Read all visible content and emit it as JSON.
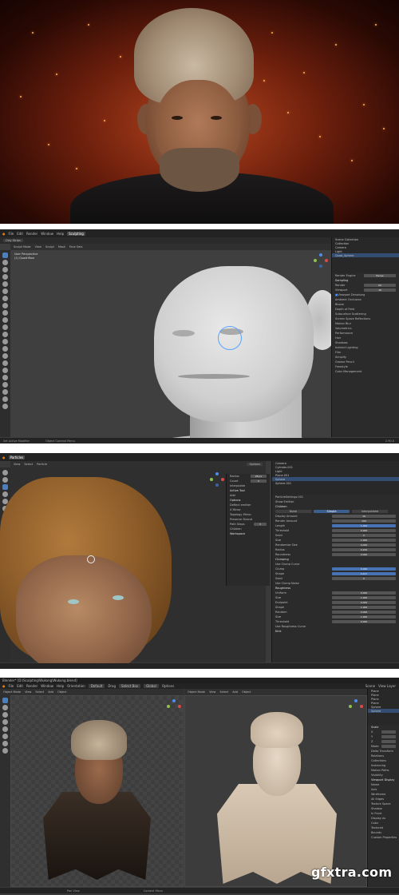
{
  "panel2": {
    "menu": [
      "File",
      "Edit",
      "Render",
      "Window",
      "Help"
    ],
    "workspace_tab": "Sculpting",
    "brush_name": "Clay Strips",
    "mode": "Sculpt Mode",
    "viewport_title": "User Perspective",
    "viewport_subtitle": "(1) Quadriflow",
    "header_menus": [
      "Sculpt Mode",
      "View",
      "Sculpt",
      "Mask",
      "Face Sets"
    ],
    "outliner_title": "Scene Collection",
    "outliner_items": [
      "Collection",
      "Camera",
      "Light",
      "Quad_Sphere"
    ],
    "props": {
      "render_engine_label": "Render Engine",
      "render_engine": "Eevee",
      "sampling": "Sampling",
      "render_label": "Render",
      "render_value": "64",
      "viewport_label": "Viewport",
      "viewport_value": "16",
      "viewport_denoising": "Viewport Denoising",
      "sections": [
        "Ambient Occlusion",
        "Bloom",
        "Depth of Field",
        "Subsurface Scattering",
        "Screen Space Reflections",
        "Motion Blur",
        "Volumetrics",
        "Performance",
        "Hair",
        "Shadows",
        "Indirect Lighting",
        "Film",
        "Simplify",
        "Grease Pencil",
        "Freestyle",
        "Color Management"
      ]
    },
    "status_left": "Set Active Modifier",
    "status_mid": "Object Context Menu",
    "version": "2.90.0"
  },
  "panel3": {
    "top_tab": "Particles",
    "header_menus": [
      "View",
      "Select",
      "Particle"
    ],
    "options_label": "Options",
    "tool_settings": {
      "radius_label": "Radius",
      "radius_value": "28 px",
      "count_label": "Count",
      "count_value": "2",
      "interpolate": "Interpolate",
      "active_tool": "Active Tool",
      "add": "Add",
      "options": "Options",
      "deflect": "Deflect emitter",
      "x_mirror": "X Mirror",
      "topology_mirror": "Topology Mirror",
      "preserve_strand": "Preserve Strand",
      "path_steps": "Path Steps",
      "path_value": "3",
      "children": "Children",
      "workspace": "Workspace"
    },
    "outliner_items": [
      "Camera",
      "Cylinder.001",
      "Light",
      "Plane.001",
      "Sphere",
      "Sphere.001"
    ],
    "particle_settings": "ParticleSettings.001",
    "props": {
      "show_emitter": "Show Emitter",
      "children": "Children",
      "tabs": [
        "None",
        "Simple",
        "Interpolated"
      ],
      "rows": [
        [
          "Display Amount",
          "10"
        ],
        [
          "Render Amount",
          "100"
        ],
        [
          "Length",
          "1.000"
        ],
        [
          "Threshold",
          "0.000"
        ],
        [
          "Seed",
          "0"
        ],
        [
          "Size",
          "1.000"
        ],
        [
          "Randomize Size",
          "0.000"
        ],
        [
          "Radius",
          "0.200"
        ],
        [
          "Roundness",
          "0.000"
        ]
      ],
      "clumping": "Clumping",
      "use_clump_curve": "Use Clump Curve",
      "clump_rows": [
        [
          "Clump",
          "0.000"
        ],
        [
          "Shape",
          "0.417"
        ],
        [
          "Seed",
          "0"
        ]
      ],
      "use_clump_noise": "Use Clump Noise",
      "roughness": "Roughness",
      "rough_rows": [
        [
          "Uniform",
          "0.000"
        ],
        [
          "Size",
          "1.000"
        ],
        [
          "Endpoint",
          "0.000"
        ],
        [
          "Shape",
          "1.000"
        ],
        [
          "Random",
          "0.000"
        ],
        [
          "Size",
          "1.000"
        ],
        [
          "Threshold",
          "0.000"
        ]
      ],
      "use_roughness_curve": "Use Roughness Curve",
      "kink": "Kink"
    }
  },
  "panel4": {
    "window_title": "Blender* [D:\\Sculpting\\Wukong\\Wukong.blend]",
    "menu": [
      "File",
      "Edit",
      "Render",
      "Window",
      "Help"
    ],
    "left_header": [
      "Object Mode",
      "View",
      "Select",
      "Add",
      "Object"
    ],
    "orientation": "Orientation",
    "default": "Default",
    "drag": "Drag",
    "select_box": "Select Box",
    "global": "Global",
    "options": "Options",
    "scene": "Scene",
    "view_layer": "View Layer",
    "outliner_items": [
      "Plane",
      "Plane",
      "Plane",
      "Plane",
      "Sphere",
      "Sphere"
    ],
    "props": {
      "scale_label": "Scale",
      "rows": [
        "X",
        "Y",
        "Z",
        "Mode"
      ],
      "delta": "Delta Transform",
      "relations": "Relations",
      "collections": "Collections",
      "instancing": "Instancing",
      "motion_paths": "Motion Paths",
      "visibility": "Visibility",
      "viewport_display": "Viewport Display",
      "name_label": "Name",
      "axis_label": "Axis",
      "wireframe": "Wireframe",
      "all_edges": "All Edges",
      "texture_space": "Texture Space",
      "shadow": "Shadow",
      "in_front": "In Front",
      "display_as": "Display As",
      "color": "Color",
      "textured": "Textured",
      "bounds": "Bounds",
      "custom_props": "Custom Properties"
    },
    "status_left": "Pan View",
    "status_mid": "Context Menu"
  },
  "watermark": "gfxtra.com"
}
